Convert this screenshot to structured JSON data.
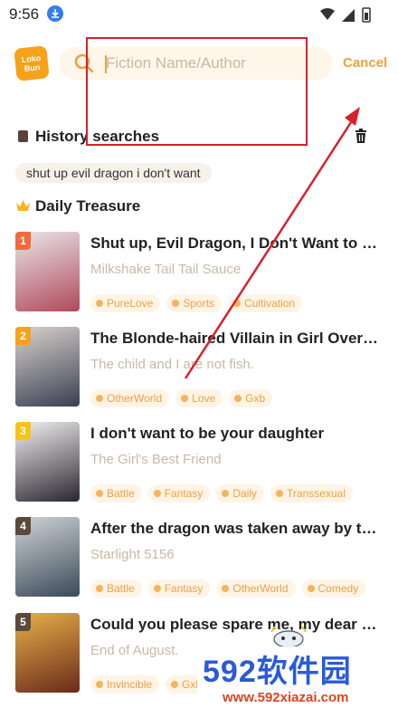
{
  "status_bar": {
    "time": "9:56"
  },
  "header": {
    "logo_lines": [
      "Loko",
      "Bun"
    ],
    "search_placeholder": "Fiction Name/Author",
    "cancel_label": "Cancel"
  },
  "history": {
    "title": "History searches",
    "items": [
      "shut up evil dragon i don't want"
    ]
  },
  "treasure": {
    "title": "Daily Treasure",
    "books": [
      {
        "rank": "1",
        "rank_color": "#f26b3a",
        "title": "Shut up, Evil Dragon, I Don't Want to Raise...",
        "author": "Milkshake Tail Tail Sauce",
        "tags": [
          "PureLove",
          "Sports",
          "Cultivation"
        ],
        "cover_colors": [
          "#e9e6ea",
          "#b0495a"
        ]
      },
      {
        "rank": "2",
        "rank_color": "#f7a21a",
        "title": "The Blonde-haired Villain in Girl Overlord ...",
        "author": "The child and I are not fish.",
        "tags": [
          "OtherWorld",
          "Love",
          "Gxb"
        ],
        "cover_colors": [
          "#d8d2cc",
          "#3a3f52"
        ]
      },
      {
        "rank": "3",
        "rank_color": "#f7c21a",
        "title": "I don't want to be your daughter",
        "author": "The Girl's Best Friend",
        "tags": [
          "Battle",
          "Fantasy",
          "Daily",
          "Transsexual"
        ],
        "cover_colors": [
          "#f2f0f0",
          "#2a2630"
        ]
      },
      {
        "rank": "4",
        "rank_color": "#5a4a3a",
        "title": "After the dragon was taken away by the pr...",
        "author": "Starlight 5156",
        "tags": [
          "Battle",
          "Fantasy",
          "OtherWorld",
          "Comedy"
        ],
        "cover_colors": [
          "#cfd4d6",
          "#3b4a58"
        ]
      },
      {
        "rank": "5",
        "rank_color": "#5a4a3a",
        "title": "Could you please spare me, my dear siste...",
        "author": "End of August.",
        "tags": [
          "Invincible",
          "Gxb"
        ],
        "cover_colors": [
          "#e8b04a",
          "#6a2a1a"
        ]
      }
    ]
  },
  "watermark": {
    "big": "592软件园",
    "small": "www.592xiazai.com"
  },
  "colors": {
    "accent": "#f0a040",
    "annotation": "#d8202c",
    "tag_bg": "#fff4e6"
  }
}
